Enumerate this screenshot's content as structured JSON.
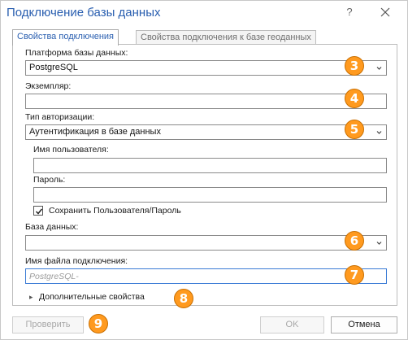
{
  "dialog": {
    "title": "Подключение базы данных",
    "help_label": "?"
  },
  "tabs": [
    {
      "label": "Свойства подключения",
      "active": true
    },
    {
      "label": "Свойства подключения к базе геоданных",
      "active": false
    }
  ],
  "form": {
    "platform_label": "Платформа базы данных:",
    "platform_value": "PostgreSQL",
    "instance_label": "Экземпляр:",
    "instance_value": "",
    "auth_label": "Тип авторизации:",
    "auth_value": "Аутентификация в базе данных",
    "username_label": "Имя пользователя:",
    "username_value": "",
    "password_label": "Пароль:",
    "password_value": "",
    "save_credentials_label": "Сохранить Пользователя/Пароль",
    "save_credentials_checked": true,
    "database_label": "База данных:",
    "database_value": "",
    "connection_file_label": "Имя файла подключения:",
    "connection_file_placeholder": "PostgreSQL-",
    "advanced_label": "Дополнительные свойства"
  },
  "badges": [
    "3",
    "4",
    "5",
    "6",
    "7",
    "8",
    "9"
  ],
  "buttons": {
    "validate_label": "Проверить",
    "ok_label": "OK",
    "cancel_label": "Отмена"
  },
  "colors": {
    "accent": "#2a5fb0",
    "badge": "#ff9a1f"
  }
}
